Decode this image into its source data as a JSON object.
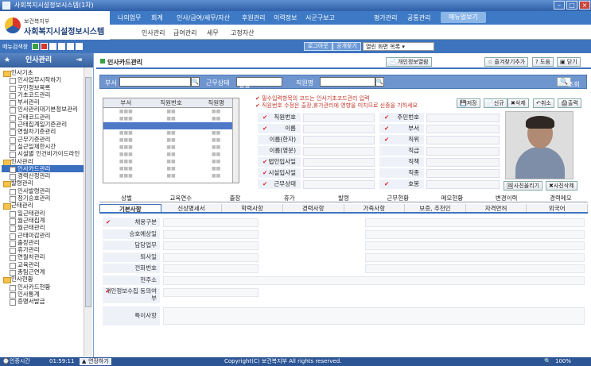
{
  "window": {
    "title": "사회복지시설정보시스템(1차)"
  },
  "logo": {
    "sub": "보건복지부",
    "main": "사회복지시설정보시스템"
  },
  "topnav": [
    "나의업무",
    "회계",
    "인사/급여/세무/자산",
    "후원관리",
    "이력정보",
    "시군구보고",
    "평가관리",
    "공통관리",
    "매뉴얼보기"
  ],
  "subnav": [
    "인사관리",
    "급여관리",
    "세무",
    "고정자산"
  ],
  "toolbar": {
    "menu_label": "메뉴검색창",
    "logout": "로그아웃",
    "change": "공개찾기",
    "open_select": "열린 화면 목록"
  },
  "sidebar": {
    "title": "인사관리",
    "items": [
      {
        "t": "cat",
        "label": "인사기초"
      },
      {
        "t": "leaf",
        "label": "인사업무시작하기"
      },
      {
        "t": "leaf",
        "label": "구인정보목록"
      },
      {
        "t": "leaf",
        "label": "기초코드관리"
      },
      {
        "t": "leaf",
        "label": "부서관리"
      },
      {
        "t": "leaf",
        "label": "인사관리대기본정보관리"
      },
      {
        "t": "leaf",
        "label": "근태코드관리"
      },
      {
        "t": "leaf",
        "label": "근태집계일기준관리"
      },
      {
        "t": "leaf",
        "label": "연월차기준관리"
      },
      {
        "t": "leaf",
        "label": "근무기준관리"
      },
      {
        "t": "leaf",
        "label": "실근일제한시간"
      },
      {
        "t": "leaf",
        "label": "시설별 인건비가이드라인"
      },
      {
        "t": "cat",
        "label": "인사관리"
      },
      {
        "t": "leaf",
        "label": "인사카드관리",
        "sel": true
      },
      {
        "t": "leaf",
        "label": "경력산정관리"
      },
      {
        "t": "cat",
        "label": "발령관리"
      },
      {
        "t": "leaf",
        "label": "인사발령관리"
      },
      {
        "t": "leaf",
        "label": "정기승호관리"
      },
      {
        "t": "cat",
        "label": "근태관리"
      },
      {
        "t": "leaf",
        "label": "일근태관리"
      },
      {
        "t": "leaf",
        "label": "월근태집계"
      },
      {
        "t": "leaf",
        "label": "월근태관리"
      },
      {
        "t": "leaf",
        "label": "근태마감관리"
      },
      {
        "t": "leaf",
        "label": "출장관리"
      },
      {
        "t": "leaf",
        "label": "휴가관리"
      },
      {
        "t": "leaf",
        "label": "연월차관리"
      },
      {
        "t": "leaf",
        "label": "교육관리"
      },
      {
        "t": "leaf",
        "label": "총팀근연계"
      },
      {
        "t": "cat",
        "label": "인사현황"
      },
      {
        "t": "leaf",
        "label": "인사카드현황"
      },
      {
        "t": "leaf",
        "label": "인사통계"
      },
      {
        "t": "leaf",
        "label": "증명서발급"
      }
    ]
  },
  "page": {
    "title": "인사카드관리",
    "btn_personal": "개인정보열람",
    "btn_fav": "즐겨찾기추가",
    "btn_help": "도움",
    "btn_close": "닫기"
  },
  "search": {
    "dept_label": "부서",
    "status_label": "근무상태",
    "status_value": "정상",
    "name_label": "직원명",
    "btn": "조회"
  },
  "grid": {
    "headers": [
      "부서",
      "직원번호",
      "직원명"
    ]
  },
  "notice": [
    "필수입력항목의 코드는 인사기초코드관리 입력",
    "직원번호 수정은 출장,휴가관리에 영향을 미치므로 신중을 기하세요"
  ],
  "actions": {
    "save": "저장",
    "new": "신규",
    "delete": "삭제",
    "cancel": "취소",
    "print": "출력"
  },
  "form": {
    "left": [
      "직원번호",
      "이름",
      "이름(한자)",
      "이름(영문)",
      "법인입사일",
      "시설입사일",
      "근무상태"
    ],
    "right": [
      "주민번호",
      "부서",
      "직위",
      "직급",
      "직책",
      "직종",
      "호봉"
    ]
  },
  "photo": {
    "register": "사진올리기",
    "delete": "사진삭제"
  },
  "tabs1": [
    "상벌",
    "교육연수",
    "출장",
    "휴가",
    "발령",
    "근무현황",
    "메모현황",
    "변경이력",
    "경력메모"
  ],
  "tabs2": [
    "기본사항",
    "신상명세서",
    "학력사항",
    "경력사항",
    "가족사항",
    "보증, 추천인",
    "자격면허",
    "외국어"
  ],
  "detail": [
    "채용구분",
    "승호예상일",
    "담당업무",
    "퇴사일",
    "전화번호",
    "현주소",
    "개인정보수집 동의여부",
    "특이사항"
  ],
  "status": {
    "login_label": "인증시간",
    "time": "01:59:11",
    "extend": "연장하기",
    "copyright": "Copyright(C) 보건복지부 All rights reserved.",
    "zoom": "100%"
  }
}
